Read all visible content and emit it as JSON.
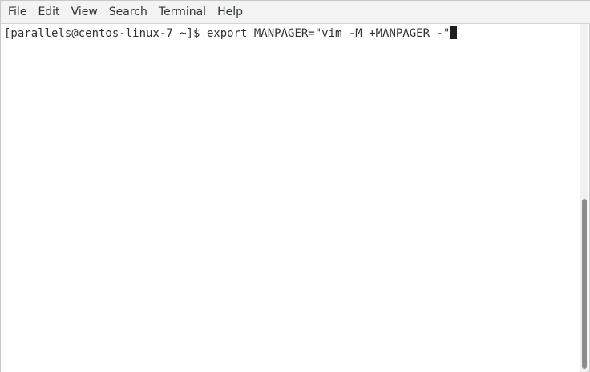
{
  "menubar": {
    "items": [
      "File",
      "Edit",
      "View",
      "Search",
      "Terminal",
      "Help"
    ]
  },
  "terminal": {
    "prompt": "[parallels@centos-linux-7 ~]$ ",
    "command": "export MANPAGER=\"vim -M +MANPAGER -\""
  }
}
